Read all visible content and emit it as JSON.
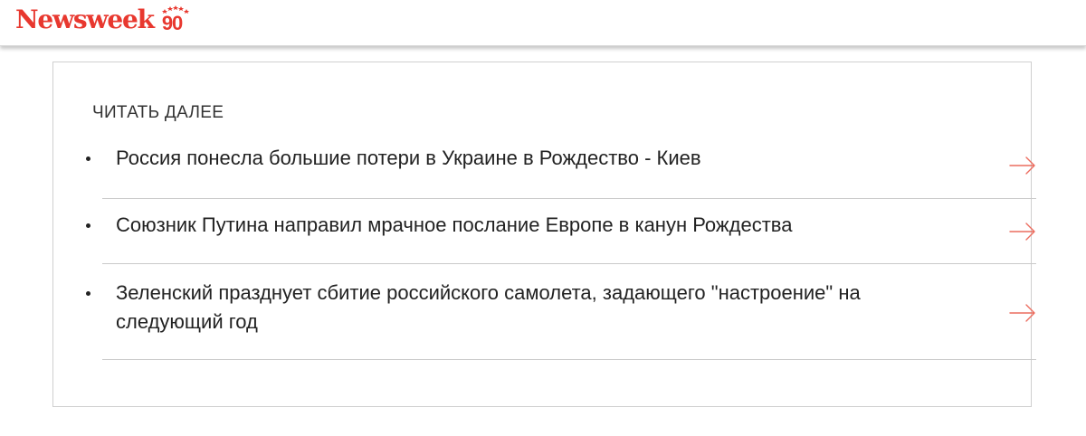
{
  "header": {
    "logo_text": "Newsweek",
    "logo_badge": "90",
    "brand_color": "#e8382f"
  },
  "read_more": {
    "title": "ЧИТАТЬ ДАЛЕЕ",
    "items": [
      {
        "text": "Россия понесла большие потери в Украине в Рождество - Киев",
        "icon": "arrow-right-icon"
      },
      {
        "text": "Союзник Путина направил мрачное послание Европе в канун Рождества",
        "icon": "arrow-right-icon"
      },
      {
        "text": "Зеленский празднует сбитие российского самолета, задающего \"настроение\" на следующий год",
        "icon": "arrow-right-icon"
      }
    ]
  }
}
